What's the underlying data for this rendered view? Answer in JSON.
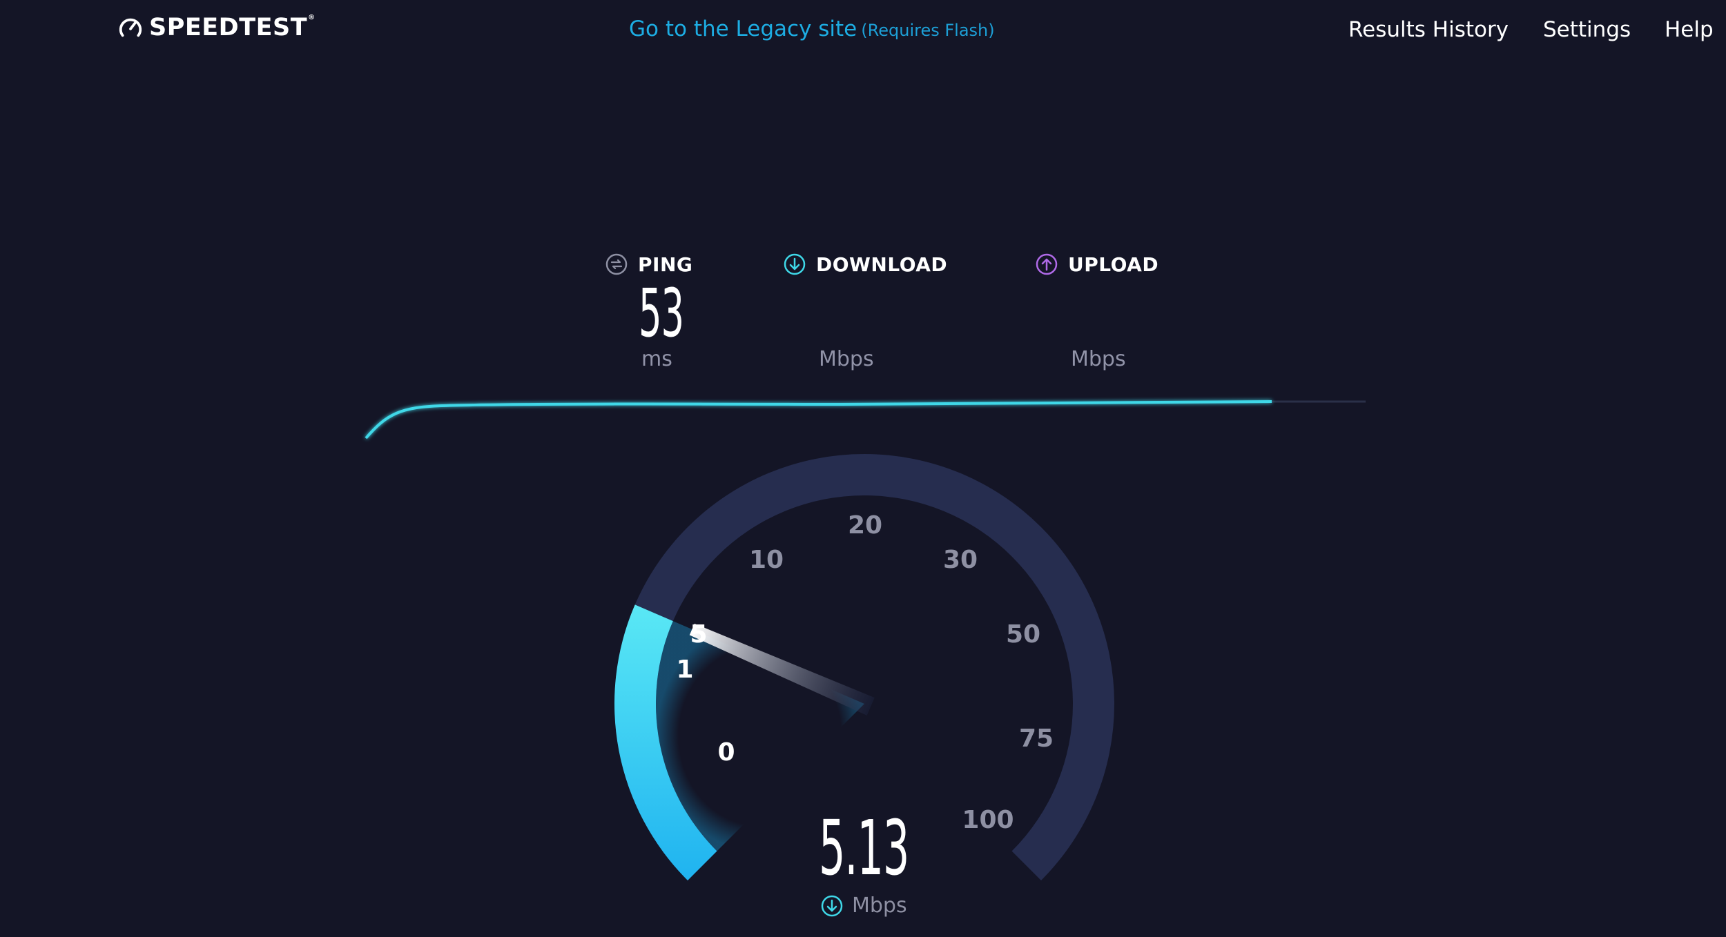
{
  "header": {
    "logo_text": "SPEEDTEST",
    "logo_tm": "®",
    "legacy_link": "Go to the Legacy site",
    "legacy_note": "(Requires Flash)",
    "nav": [
      "Results History",
      "Settings",
      "Help"
    ]
  },
  "metrics": {
    "ping": {
      "label": "PING",
      "value": "53",
      "unit": "ms",
      "icon": "ping-icon"
    },
    "download": {
      "label": "DOWNLOAD",
      "value": "",
      "unit": "Mbps",
      "icon": "download-arrow-icon"
    },
    "upload": {
      "label": "UPLOAD",
      "value": "",
      "unit": "Mbps",
      "icon": "upload-arrow-icon"
    }
  },
  "gauge": {
    "current_value": "5.13",
    "current_unit": "Mbps",
    "scale_labels": [
      "0",
      "1",
      "5",
      "10",
      "20",
      "30",
      "50",
      "75",
      "100"
    ],
    "active_labels": [
      "0",
      "1",
      "5"
    ],
    "needle_value": 5.13,
    "progress_fraction_of_test": 0.91
  },
  "colors": {
    "background": "#141526",
    "accent_cyan": "#3fd8e8",
    "gauge_track": "#262d4f",
    "gauge_fill_top": "#5ae8f5",
    "gauge_fill_bottom": "#1fb3f0",
    "legacy_link": "#1dade3",
    "upload_purple": "#b06ae8",
    "muted_text": "#9193a8"
  }
}
